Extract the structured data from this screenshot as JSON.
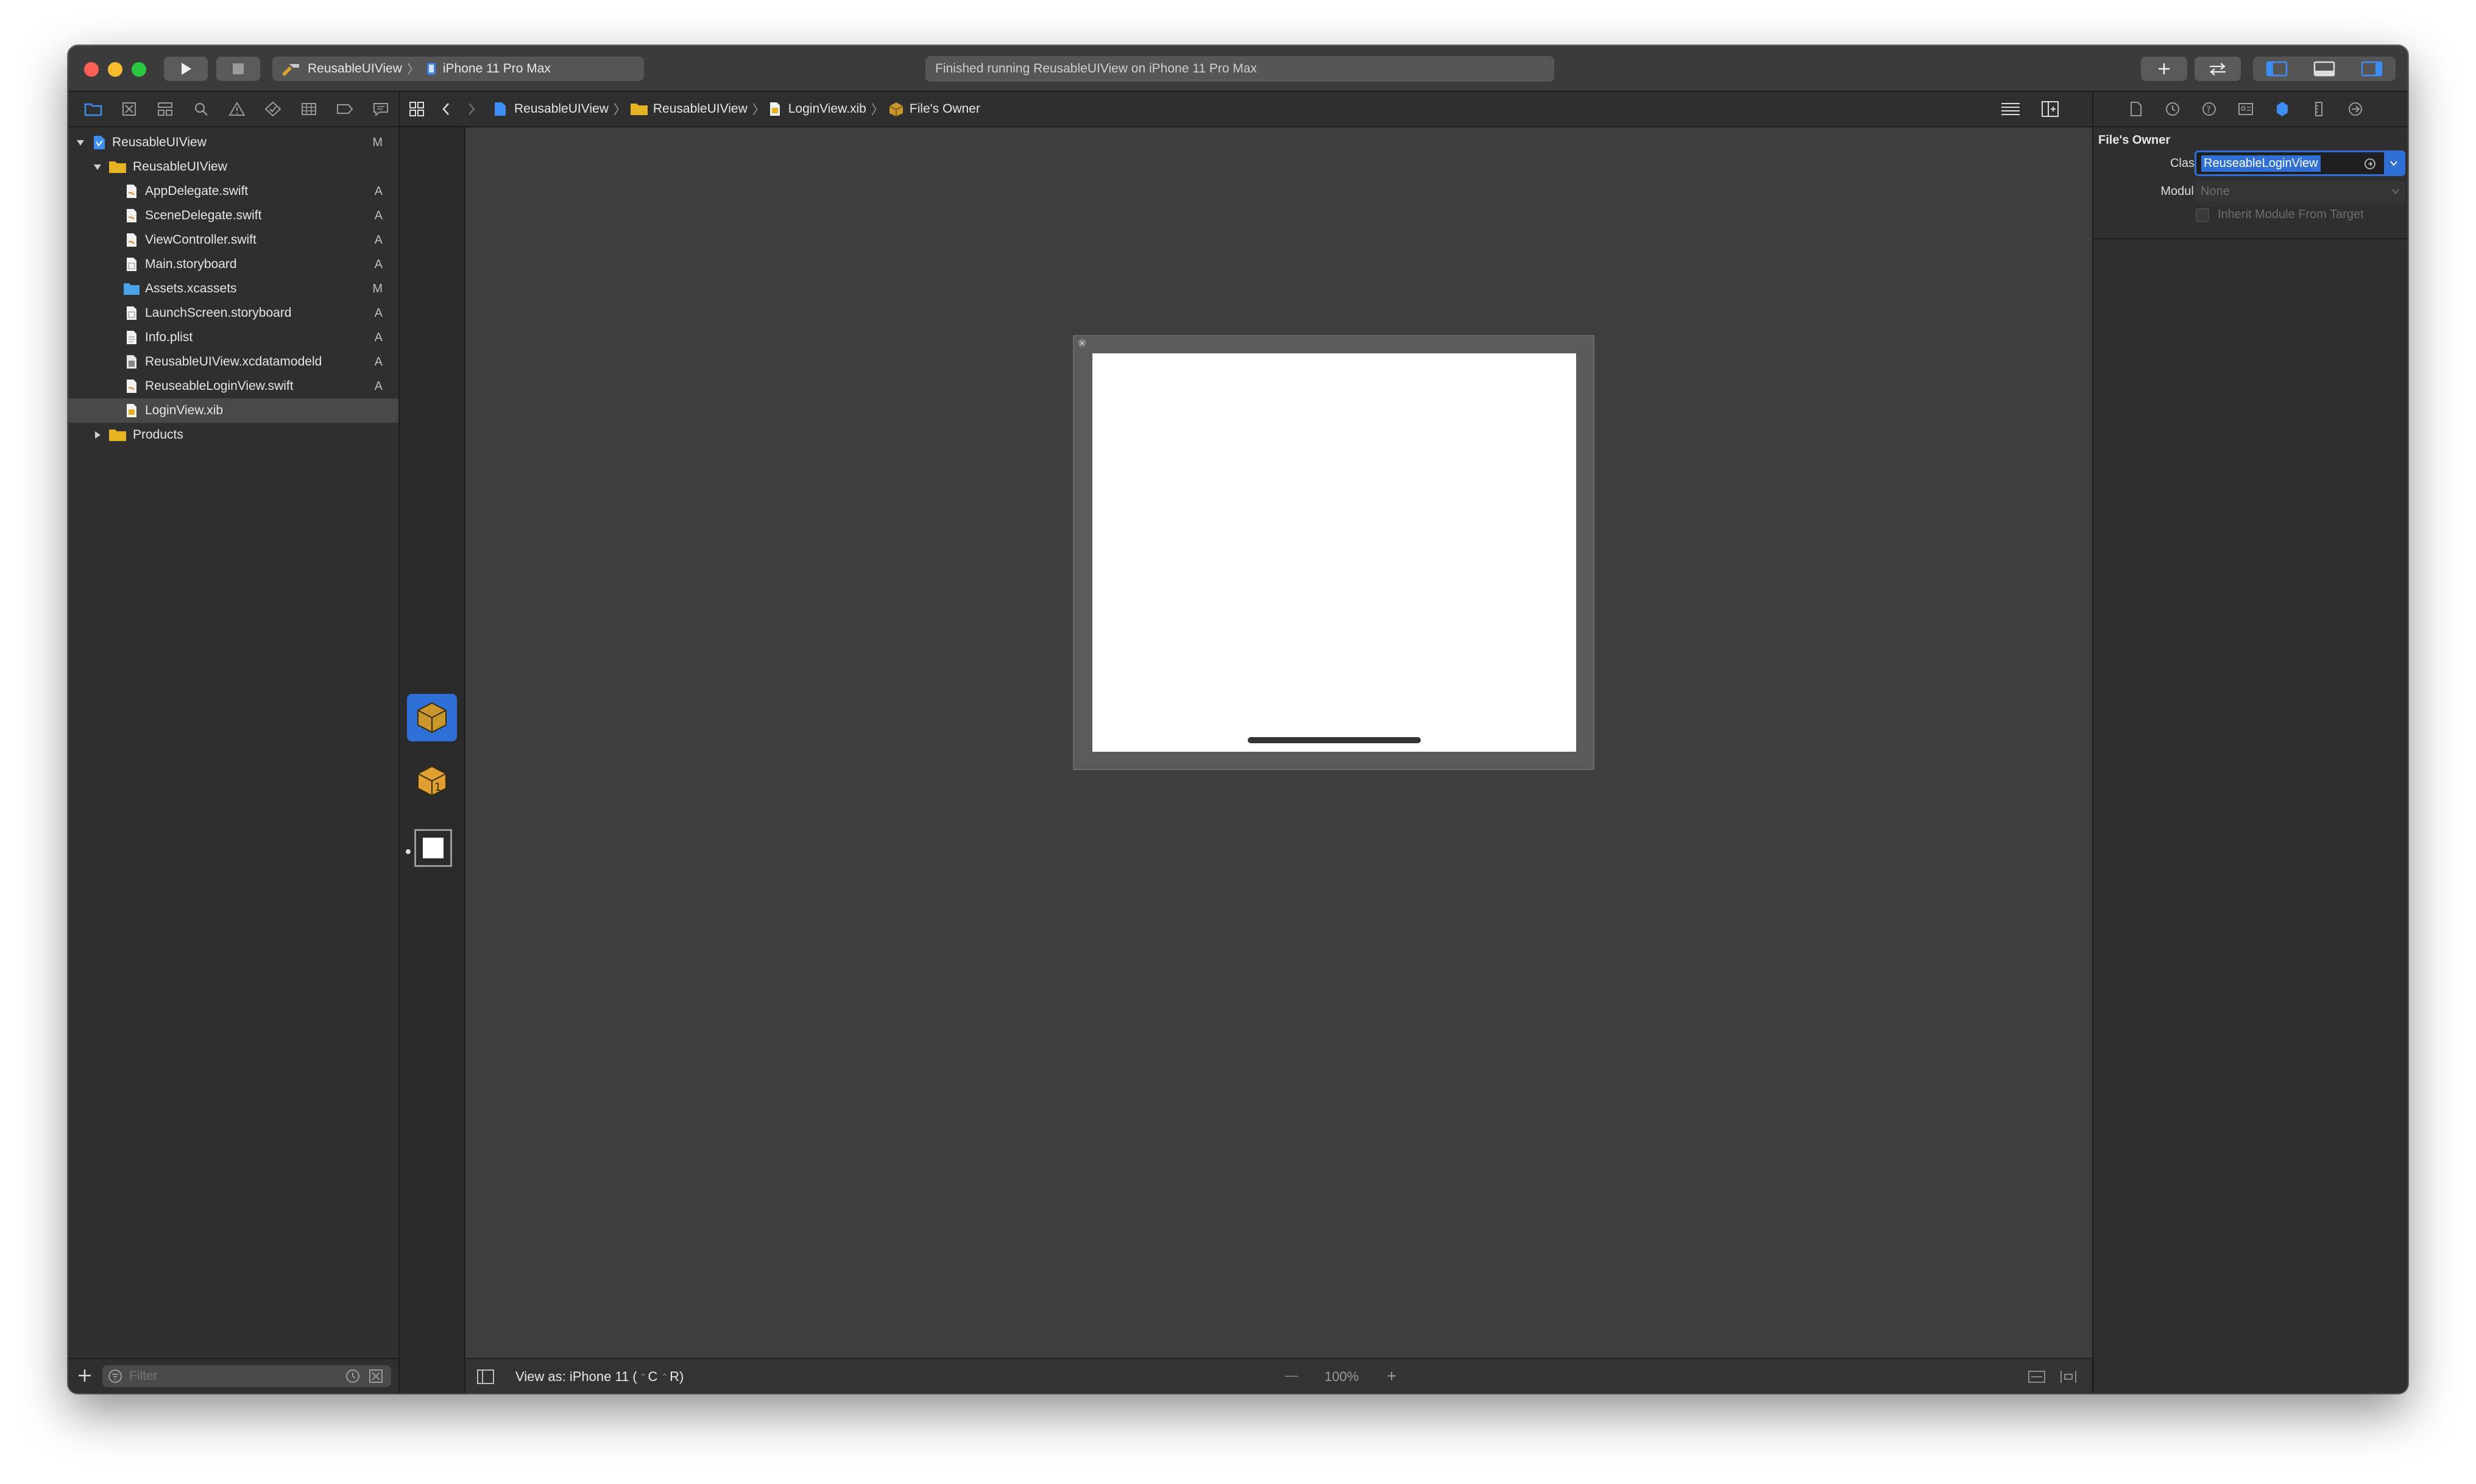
{
  "toolbar": {
    "scheme_target": "ReusableUIView",
    "scheme_separator": "〉",
    "scheme_device": "iPhone 11 Pro Max",
    "activity_status": "Finished running ReusableUIView on iPhone 11 Pro Max",
    "icons": [
      "run-icon",
      "stop-icon",
      "library-plus-icon",
      "code-review-icon",
      "navigator-toggle-icon",
      "debug-area-toggle-icon",
      "inspector-toggle-icon"
    ]
  },
  "navigator": {
    "tabs": [
      "folder-icon",
      "source-control-icon",
      "symbol-icon",
      "find-icon",
      "issue-icon",
      "test-icon",
      "debug-icon",
      "breakpoint-icon",
      "report-icon"
    ],
    "items": [
      {
        "label": "ReusableUIView",
        "status": "M",
        "kind": "project"
      },
      {
        "label": "ReusableUIView",
        "status": "",
        "kind": "group"
      },
      {
        "label": "AppDelegate.swift",
        "status": "A",
        "kind": "file"
      },
      {
        "label": "SceneDelegate.swift",
        "status": "A",
        "kind": "file"
      },
      {
        "label": "ViewController.swift",
        "status": "A",
        "kind": "file"
      },
      {
        "label": "Main.storyboard",
        "status": "A",
        "kind": "file"
      },
      {
        "label": "Assets.xcassets",
        "status": "M",
        "kind": "assets"
      },
      {
        "label": "LaunchScreen.storyboard",
        "status": "A",
        "kind": "file"
      },
      {
        "label": "Info.plist",
        "status": "A",
        "kind": "file"
      },
      {
        "label": "ReusableUIView.xcdatamodeld",
        "status": "A",
        "kind": "datamodel"
      },
      {
        "label": "ReuseableLoginView.swift",
        "status": "A",
        "kind": "file"
      },
      {
        "label": "LoginView.xib",
        "status": "",
        "kind": "xib"
      },
      {
        "label": "Products",
        "status": "",
        "kind": "group"
      }
    ],
    "filter_placeholder": "Filter"
  },
  "jumpbar": {
    "crumbs": [
      "ReusableUIView",
      "ReusableUIView",
      "LoginView.xib",
      "File's Owner"
    ],
    "separator": "〉"
  },
  "editor": {
    "view_as_label": "View as: iPhone 11 (",
    "view_as_shortcut_1": "C",
    "view_as_shortcut_2": "R)",
    "zoom_minus": "—",
    "zoom_level": "100%",
    "zoom_plus": "+"
  },
  "inspector": {
    "tabs": [
      "file-inspector-icon",
      "history-inspector-icon",
      "quick-help-icon",
      "identity-inspector-icon",
      "attributes-inspector-icon",
      "size-inspector-icon",
      "connections-inspector-icon",
      "bindings-inspector-icon"
    ],
    "section_title": "File's Owner",
    "class_label": "Class",
    "class_value": "ReuseableLoginView",
    "module_label": "Module",
    "module_placeholder": "None",
    "inherit_label": "Inherit Module From Target",
    "inherit_checked": false
  },
  "colors": {
    "accent": "#2f6fd6",
    "folder": "#e6b422",
    "window_bg": "#2b2b2b",
    "canvas_bg": "#3e3e3e"
  }
}
